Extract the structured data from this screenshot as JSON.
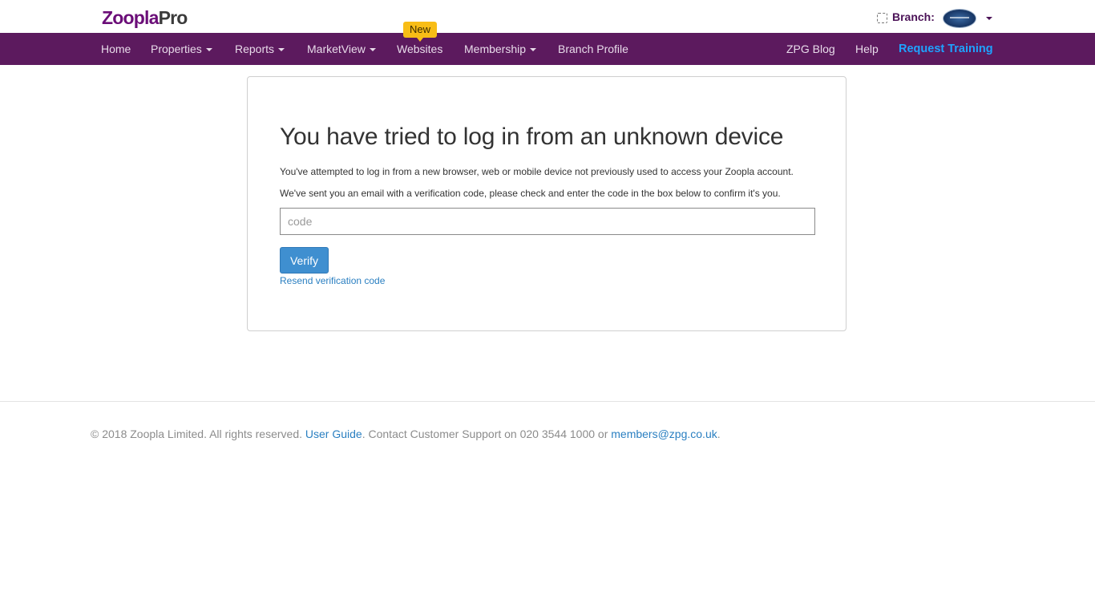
{
  "header": {
    "logo_brand": "Zoopla",
    "logo_suffix": "Pro",
    "branch_label": "Branch:"
  },
  "nav": {
    "left": [
      {
        "label": "Home",
        "dropdown": false
      },
      {
        "label": "Properties",
        "dropdown": true
      },
      {
        "label": "Reports",
        "dropdown": true
      },
      {
        "label": "MarketView",
        "dropdown": true
      },
      {
        "label": "Websites",
        "dropdown": false,
        "badge": "New"
      },
      {
        "label": "Membership",
        "dropdown": true
      },
      {
        "label": "Branch Profile",
        "dropdown": false
      }
    ],
    "right": [
      {
        "label": "ZPG Blog"
      },
      {
        "label": "Help"
      },
      {
        "label": "Request Training"
      }
    ]
  },
  "card": {
    "title": "You have tried to log in from an unknown device",
    "paragraph1": "You've attempted to log in from a new browser, web or mobile device not previously used to access your Zoopla account.",
    "paragraph2": "We've sent you an email with a verification code, please check and enter the code in the box below to confirm it's you.",
    "code_value": "",
    "code_placeholder": "code",
    "verify_label": "Verify",
    "resend_label": "Resend verification code"
  },
  "footer": {
    "copyright": "© 2018 Zoopla Limited. All rights reserved.",
    "user_guide": "User Guide",
    "contact_text": ". Contact Customer Support on 020 3544 1000 or",
    "email": "members@zpg.co.uk",
    "end": "."
  },
  "colors": {
    "nav_bg": "#5c1a5e",
    "brand_purple": "#6b0e78",
    "badge_yellow": "#f8bd16",
    "request_training": "#1ea3ff",
    "primary_button": "#3f8fd0",
    "link": "#2a7fc1"
  }
}
